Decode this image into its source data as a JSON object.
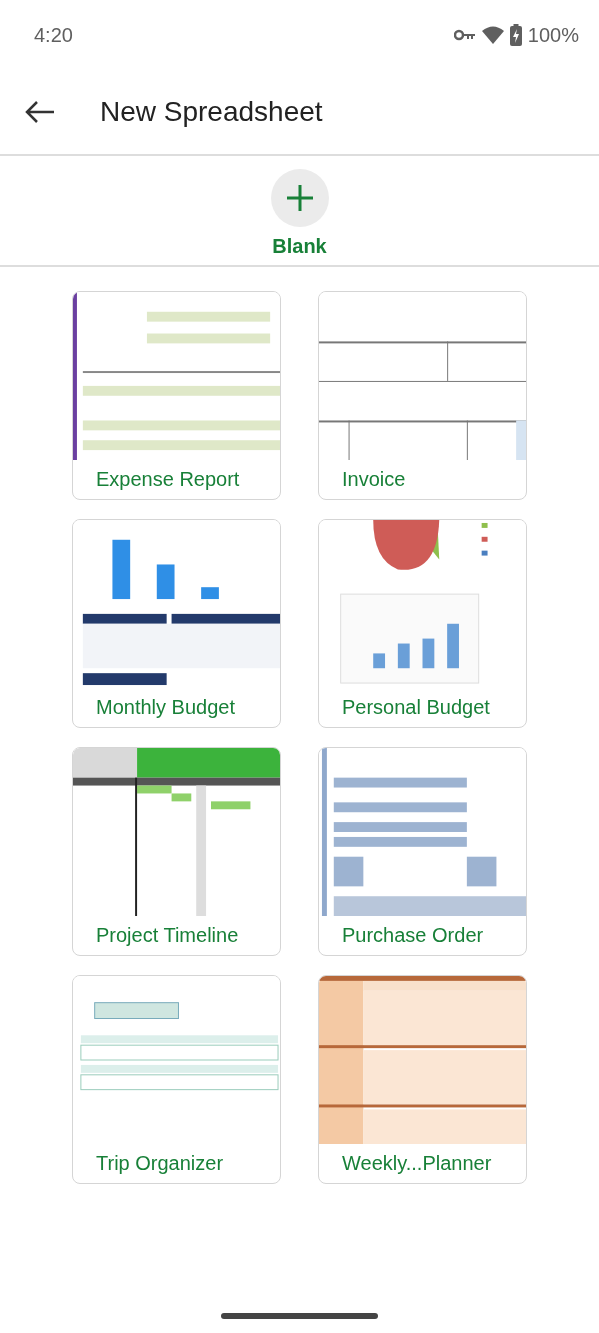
{
  "status_bar": {
    "time": "4:20",
    "battery": "100%"
  },
  "app_bar": {
    "title": "New Spreadsheet"
  },
  "blank": {
    "label": "Blank"
  },
  "templates": [
    {
      "name": "Expense Report"
    },
    {
      "name": "Invoice"
    },
    {
      "name": "Monthly Budget"
    },
    {
      "name": "Personal Budget"
    },
    {
      "name": "Project Timeline"
    },
    {
      "name": "Purchase Order"
    },
    {
      "name": "Trip Organizer"
    },
    {
      "name": "Weekly...Planner"
    }
  ]
}
